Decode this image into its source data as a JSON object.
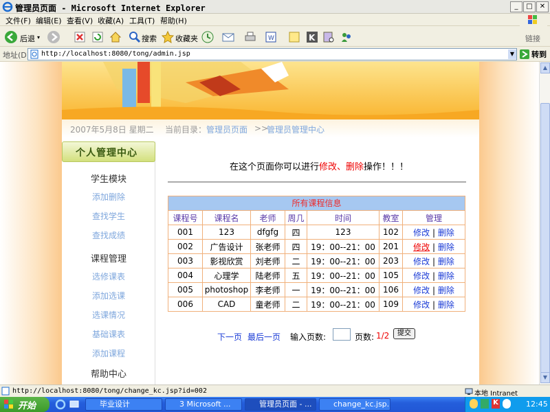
{
  "window": {
    "title": "管理员页面 - Microsoft Internet Explorer",
    "min": "_",
    "max": "□",
    "close": "✕"
  },
  "menu": [
    "文件(F)",
    "编辑(E)",
    "查看(V)",
    "收藏(A)",
    "工具(T)",
    "帮助(H)"
  ],
  "toolbar": {
    "back": "后退",
    "search": "搜索",
    "favorites": "收藏夹",
    "links": "链接"
  },
  "address": {
    "label": "地址(D)",
    "url": "http://localhost:8080/tong/admin.jsp",
    "go": "转到"
  },
  "page": {
    "date": "2007年5月8日  星期二",
    "breadcrumb_prefix": "当前目录：",
    "breadcrumb_1": "管理员页面",
    "breadcrumb_sep": ">>",
    "breadcrumb_2": "管理员管理中心",
    "sidebar": {
      "title": "个人管理中心",
      "sections": [
        {
          "label": "学生模块",
          "links": [
            "添加删除",
            "查找学生",
            "查找成绩"
          ]
        },
        {
          "label": "课程管理",
          "links": [
            "选修课表",
            "添加选课",
            "选课情况",
            "基础课表",
            "添加课程"
          ]
        },
        {
          "label": "帮助中心",
          "links": []
        }
      ]
    },
    "notice": {
      "pre": "在这个页面你可以进行",
      "edit": "修改、",
      "del": "删除",
      "post": "操作！！！"
    },
    "table": {
      "caption": "所有课程信息",
      "headers": [
        "课程号",
        "课程名",
        "老师",
        "周几",
        "时间",
        "教室",
        "管理"
      ],
      "rows": [
        [
          "001",
          "123",
          "dfgfg",
          "四",
          "123",
          "102"
        ],
        [
          "002",
          "广告设计",
          "张老师",
          "四",
          "19：00--21：00",
          "201"
        ],
        [
          "003",
          "影视欣赏",
          "刘老师",
          "二",
          "19：00--21：00",
          "203"
        ],
        [
          "004",
          "心理学",
          "陆老师",
          "五",
          "19：00--21：00",
          "105"
        ],
        [
          "005",
          "photoshop",
          "李老师",
          "一",
          "19：00--21：00",
          "106"
        ],
        [
          "006",
          "CAD",
          "童老师",
          "二",
          "19：00--21：00",
          "109"
        ]
      ],
      "edit_label": "修改",
      "sep": "|",
      "delete_label": "删除"
    },
    "pager": {
      "next": "下一页",
      "last": "最后一页",
      "input_label": "输入页数:",
      "pages_label": "页数:",
      "pages_value": "1/2",
      "submit": "提交"
    }
  },
  "status": {
    "url": "http://localhost:8080/tong/change_kc.jsp?id=002",
    "zone": "本地 Intranet"
  },
  "taskbar": {
    "start": "开始",
    "tasks": [
      "毕业设计",
      "3 Microsoft ...",
      "管理员页面 - ...",
      "change_kc.jsp..."
    ],
    "clock": "12:45"
  },
  "colors": {
    "accent_red": "#ee0000",
    "link_blue": "#1a3bd6",
    "sidebar_link": "#7fa7dd",
    "table_border": "#f0b07a",
    "caption_bg": "#a6c8f1"
  }
}
